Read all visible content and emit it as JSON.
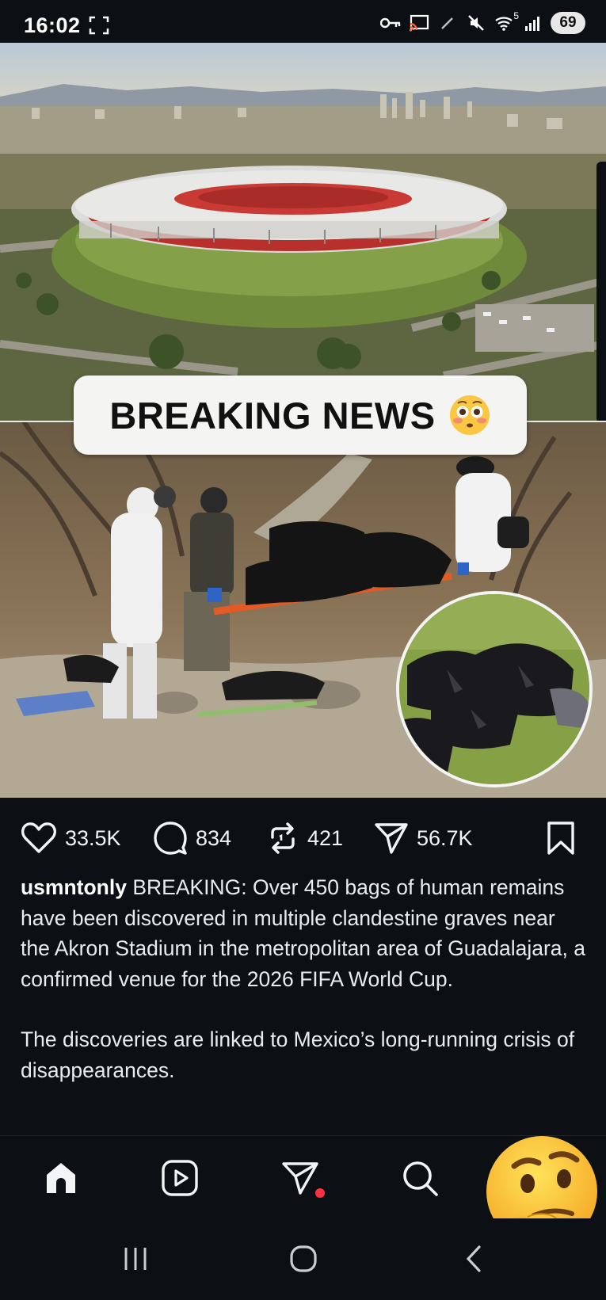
{
  "status_bar": {
    "time": "16:02",
    "battery": "69",
    "network": "5",
    "icons": [
      "screenshot-icon",
      "vpn-key-icon",
      "cast-icon",
      "edit-icon",
      "mute-icon",
      "wifi-icon",
      "signal-icon"
    ]
  },
  "post": {
    "image_banner": "BREAKING NEWS",
    "banner_emoji": "flushed-face",
    "likes": "33.5K",
    "comments": "834",
    "reposts": "421",
    "shares": "56.7K",
    "username": "usmntonly",
    "caption_first": " BREAKING: Over 450 bags of human remains have been discovered in multiple clandestine graves near the Akron Stadium in the metropolitan area of Guadalajara, a confirmed venue for the 2026 FIFA World Cup.",
    "caption_second": "The discoveries are linked to Mexico’s long-running crisis of disappearances."
  },
  "bottom_nav": {
    "items": [
      "home-icon",
      "reels-icon",
      "direct-messages-icon",
      "search-icon",
      "profile"
    ],
    "dm_notification_color": "#ff3040",
    "overlay_emoji": "thinking-face"
  },
  "colors": {
    "background": "#0c1014",
    "text": "#f2f4f6",
    "banner_bg": "#f4f4f2"
  }
}
